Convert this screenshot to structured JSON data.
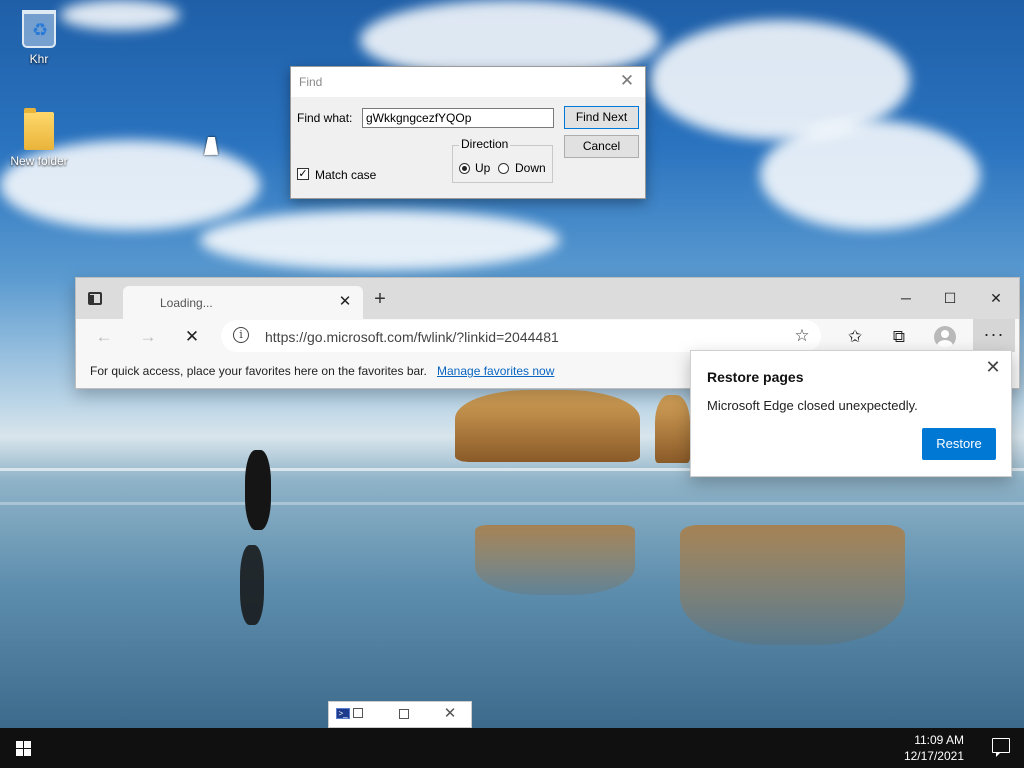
{
  "desktop": {
    "icons": [
      {
        "label": "Khr",
        "icon": "recycle-bin-icon"
      },
      {
        "label": "New folder",
        "icon": "folder-icon"
      }
    ]
  },
  "find_dialog": {
    "title": "Find",
    "find_what_label": "Find what:",
    "find_what_value": "gWkkgngcezfYQOp",
    "find_next_label": "Find Next",
    "cancel_label": "Cancel",
    "match_case_label": "Match case",
    "match_case_checked": true,
    "direction_label": "Direction",
    "up_label": "Up",
    "down_label": "Down",
    "direction_selected": "Up"
  },
  "edge": {
    "tab_title": "Loading...",
    "url": "https://go.microsoft.com/fwlink/?linkid=2044481",
    "favorites_message": "For quick access, place your favorites here on the favorites bar.",
    "favorites_link": "Manage favorites now",
    "more_label": "···"
  },
  "restore_popup": {
    "title": "Restore pages",
    "message": "Microsoft Edge closed unexpectedly.",
    "button_label": "Restore"
  },
  "taskbar": {
    "time": "11:09 AM",
    "date": "12/17/2021"
  },
  "colors": {
    "accent": "#0078d4",
    "taskbar": "#101010",
    "link": "#0a66c2"
  }
}
